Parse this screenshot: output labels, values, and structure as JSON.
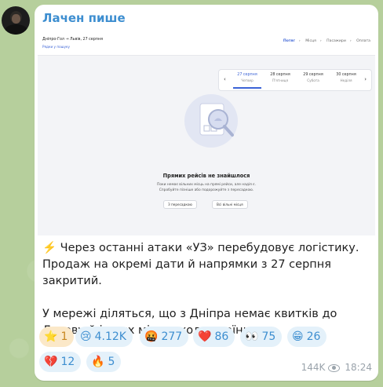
{
  "channel": {
    "name": "Лачен пише"
  },
  "screenshot": {
    "route": "Дніпро-Гол → Львів, 27 серпня",
    "sub_link": "Рядки у пошуку",
    "steps": [
      "Потяг",
      "Місця",
      "Пасажири",
      "Оплата"
    ],
    "dates": [
      {
        "date": "27 серпня",
        "weekday": "Четвер",
        "active": true
      },
      {
        "date": "28 серпня",
        "weekday": "П'ятниця",
        "active": false
      },
      {
        "date": "29 серпня",
        "weekday": "Субота",
        "active": false
      },
      {
        "date": "30 серпня",
        "weekday": "Неділя",
        "active": false
      }
    ],
    "empty_title": "Прямих рейсів не знайшлося",
    "empty_text_1": "Поки немає вільних місць на прямі рейси, але надія є.",
    "empty_text_2": "Спробуйте пізніше або подорожуйте з пересадкою.",
    "btn_transfer": "З пересадкою",
    "btn_free": "Всі вільні місця"
  },
  "message": {
    "paragraph_1": "⚡️ Через останні атаки «УЗ» перебудовує логістику. Продаж на окремі дати й напрямки з 27 серпня закритий.",
    "paragraph_2": "У мережі діляться, що з Дніпра немає квитків до Львову й інших міст заходу країни."
  },
  "reactions": [
    {
      "emoji": "⭐",
      "count": "1",
      "type": "paid"
    },
    {
      "emoji": "😢",
      "count": "4.12K",
      "type": "normal"
    },
    {
      "emoji": "🤬",
      "count": "277",
      "type": "normal"
    },
    {
      "emoji": "❤️",
      "count": "86",
      "type": "normal"
    },
    {
      "emoji": "👀",
      "count": "75",
      "type": "normal"
    },
    {
      "emoji": "😁",
      "count": "26",
      "type": "normal"
    },
    {
      "emoji": "💔",
      "count": "12",
      "type": "normal"
    },
    {
      "emoji": "🔥",
      "count": "5",
      "type": "normal"
    }
  ],
  "meta": {
    "views": "144K",
    "time": "18:24"
  },
  "colors": {
    "accent": "#3d8ed0",
    "reaction_bg": "#e4f1fa",
    "paid_bg": "#fbe8c8"
  }
}
